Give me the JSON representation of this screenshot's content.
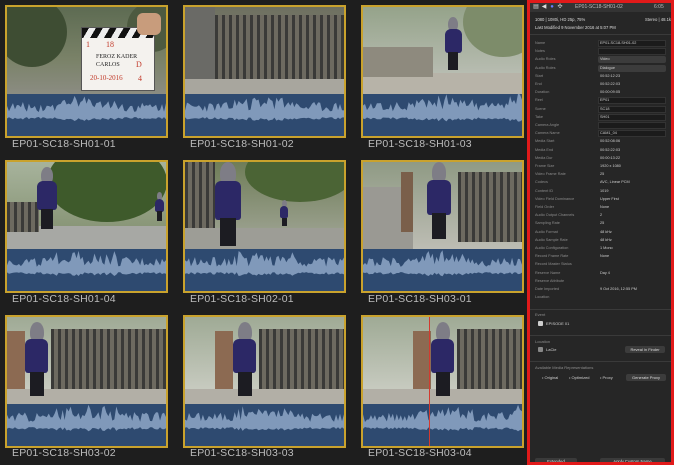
{
  "browser": {
    "clips": [
      {
        "name": "EP01-SC18-SH01-01"
      },
      {
        "name": "EP01-SC18-SH01-02"
      },
      {
        "name": "EP01-SC18-SH01-03"
      },
      {
        "name": "EP01-SC18-SH01-04"
      },
      {
        "name": "EP01-SC18-SH02-01"
      },
      {
        "name": "EP01-SC18-SH03-01"
      },
      {
        "name": "EP01-SC18-SH03-02"
      },
      {
        "name": "EP01-SC18-SH03-03"
      },
      {
        "name": "EP01-SC18-SH03-04"
      }
    ],
    "slate": {
      "scene": "18",
      "director": "FEROZ KADER",
      "camera": "CARLOS",
      "date": "20-10-2016",
      "take": "4",
      "roll": "1",
      "d_mark": "D"
    }
  },
  "inspector": {
    "clip_title": "EP01-SC18-SH01-02",
    "duration": "6:05",
    "video_info": "1080 | 1080i, HD 25p, 75%",
    "audio_info": "Stereo | 48.1k",
    "modified": "Last Modified 9 November 2016 at 5:07 PM",
    "rows": [
      {
        "label": "Name",
        "value": "EP01-SC18-SH01-02"
      },
      {
        "label": "Notes",
        "value": ""
      },
      {
        "label": "Audio Roles",
        "value": "Video"
      },
      {
        "label": "Audio Roles",
        "value": "Dialogue"
      },
      {
        "label": "Start",
        "value": "00:52:12:23"
      },
      {
        "label": "End",
        "value": "00:52:22:03"
      },
      {
        "label": "Duration",
        "value": "00:00:09:05"
      },
      {
        "label": "Reel",
        "value": "EP01"
      },
      {
        "label": "Scene",
        "value": "SC18"
      },
      {
        "label": "Take",
        "value": "SH01"
      },
      {
        "label": "Camera Angle",
        "value": ""
      },
      {
        "label": "Camera Name",
        "value": "CAM1_04"
      },
      {
        "label": "Media Start",
        "value": "00:52:08:06"
      },
      {
        "label": "Media End",
        "value": "00:52:22:03"
      },
      {
        "label": "Media Dur",
        "value": "00:00:13:22"
      },
      {
        "label": "Frame Size",
        "value": "1920 x 1080"
      },
      {
        "label": "Video Frame Rate",
        "value": "25"
      },
      {
        "label": "Codecs",
        "value": "AVC, Linear PCM"
      },
      {
        "label": "Content ID",
        "value": "1019"
      },
      {
        "label": "Video Field Dominance",
        "value": "Upper First"
      },
      {
        "label": "Field Order",
        "value": "None"
      },
      {
        "label": "Audio Output Channels",
        "value": "2"
      },
      {
        "label": "Sampling Rate",
        "value": "25"
      },
      {
        "label": "Audio Format",
        "value": "48 kHz"
      },
      {
        "label": "Audio Sample Rate",
        "value": "48 kHz"
      },
      {
        "label": "Audio Configuration",
        "value": "1 Mono"
      },
      {
        "label": "Record Frame Rate",
        "value": "None"
      },
      {
        "label": "Record Master Status",
        "value": ""
      },
      {
        "label": "Reserve Name",
        "value": "Day 4"
      },
      {
        "label": "Reserve Attribute",
        "value": ""
      },
      {
        "label": "Date Imported",
        "value": "9 Oct 2016, 12:55 PM"
      },
      {
        "label": "Location",
        "value": ""
      }
    ],
    "event_label": "Event",
    "event_name": "EPISODE 01",
    "location_label": "Location",
    "location_name": "LaCie",
    "reveal_button": "Reveal in Finder",
    "representation_label": "Available Media Representations",
    "rep_original": "Original",
    "rep_optimized": "Optimized",
    "rep_proxy": "Proxy",
    "generate_button": "Generate Proxy",
    "extended_button": "Extended",
    "apply_button": "Apply Custom Name"
  },
  "colors": {
    "selection": "#c9a22d",
    "waveform_bg": "#2e4a70",
    "waveform": "#8ea7c7",
    "inspector_border": "#e11a1a",
    "playhead": "#d33a2f"
  }
}
